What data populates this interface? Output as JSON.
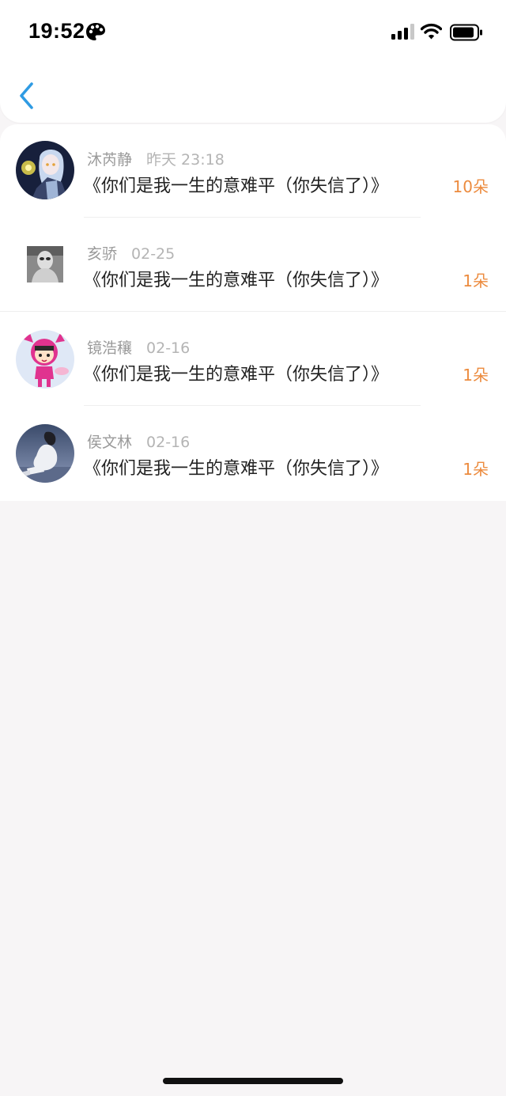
{
  "status_bar": {
    "time": "19:52",
    "icons": [
      "palette-icon",
      "signal-icon",
      "wifi-icon",
      "battery-icon"
    ]
  },
  "nav": {
    "back_icon": "chevron-left-icon",
    "accent_color": "#2f9be3"
  },
  "list": {
    "items": [
      {
        "name": "沐芮静",
        "date": "昨天 23:18",
        "title": "《你们是我一生的意难平（你失信了）》",
        "count": "10朵"
      },
      {
        "name": "亥骄",
        "date": "02-25",
        "title": "《你们是我一生的意难平（你失信了）》",
        "count": "1朵"
      },
      {
        "name": "镜浩穰",
        "date": "02-16",
        "title": "《你们是我一生的意难平（你失信了）》",
        "count": "1朵"
      },
      {
        "name": "侯文林",
        "date": "02-16",
        "title": "《你们是我一生的意难平（你失信了）》",
        "count": "1朵"
      }
    ]
  },
  "colors": {
    "count": "#ec8b3e",
    "background": "#f7f5f6",
    "card": "#ffffff"
  }
}
